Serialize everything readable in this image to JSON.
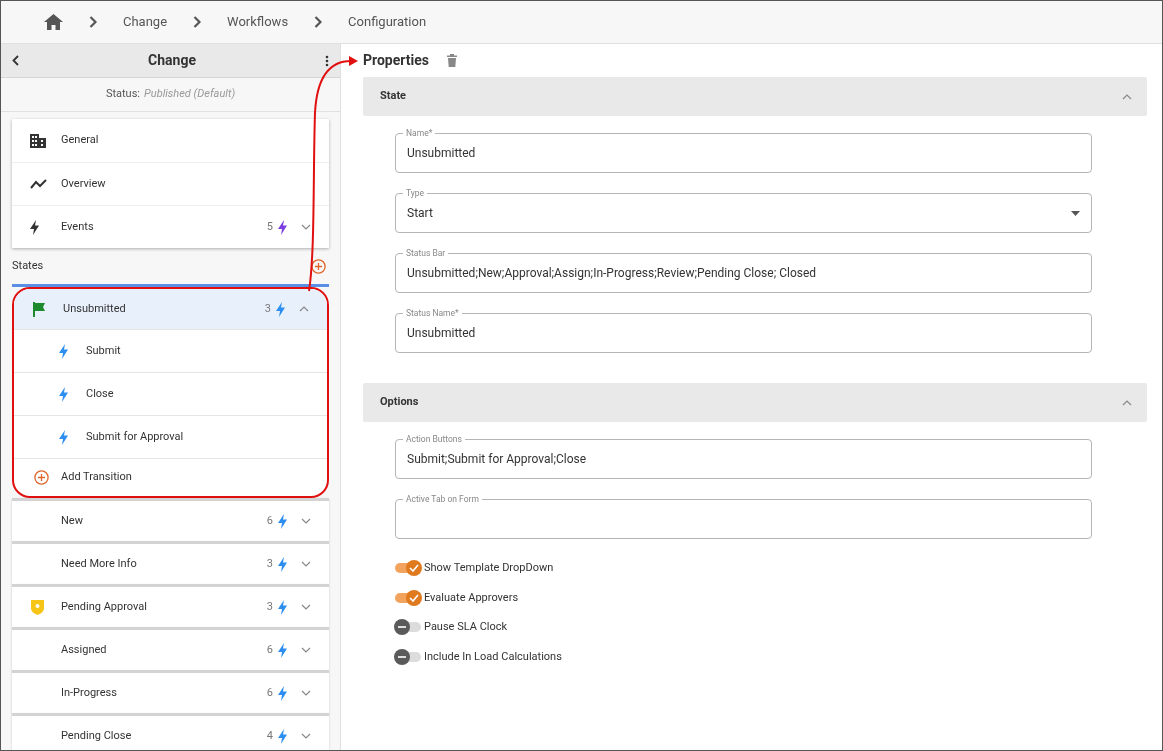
{
  "breadcrumb": [
    {
      "label": "Change"
    },
    {
      "label": "Workflows"
    },
    {
      "label": "Configuration"
    }
  ],
  "sidebar": {
    "title": "Change",
    "status_label": "Status:",
    "status_value": "Published (Default)",
    "items": [
      {
        "label": "General",
        "kind": "building"
      },
      {
        "label": "Overview",
        "kind": "trend"
      },
      {
        "label": "Events",
        "kind": "bolt",
        "count": "5",
        "expanded": false
      }
    ],
    "states_label": "States",
    "states": [
      {
        "name": "Unsubmitted",
        "kind": "flag",
        "count": "3",
        "expanded": true,
        "transitions": [
          "Submit",
          "Close",
          "Submit for Approval"
        ],
        "add_label": "Add Transition"
      },
      {
        "name": "New",
        "count": "6",
        "expanded": false
      },
      {
        "name": "Need More Info",
        "count": "3",
        "expanded": false
      },
      {
        "name": "Pending Approval",
        "kind": "shield",
        "count": "3",
        "expanded": false
      },
      {
        "name": "Assigned",
        "count": "6",
        "expanded": false
      },
      {
        "name": "In-Progress",
        "count": "6",
        "expanded": false
      },
      {
        "name": "Pending Close",
        "count": "4",
        "expanded": false
      }
    ]
  },
  "properties": {
    "title": "Properties",
    "sections": [
      {
        "title": "State",
        "expanded": true,
        "fields": [
          {
            "label": "Name*",
            "value": "Unsubmitted",
            "kind": "text"
          },
          {
            "label": "Type",
            "value": "Start",
            "kind": "select"
          },
          {
            "label": "Status Bar",
            "value": "Unsubmitted;New;Approval;Assign;In-Progress;Review;Pending Close; Closed",
            "kind": "text"
          },
          {
            "label": "Status Name*",
            "value": "Unsubmitted",
            "kind": "text"
          }
        ]
      },
      {
        "title": "Options",
        "expanded": true,
        "fields": [
          {
            "label": "Action Buttons",
            "value": "Submit;Submit for Approval;Close",
            "kind": "text"
          },
          {
            "label": "Active Tab on Form",
            "kind": "text"
          }
        ],
        "toggles": [
          {
            "label": "Show Template DropDown",
            "on": true
          },
          {
            "label": "Evaluate Approvers",
            "on": true
          },
          {
            "label": "Pause SLA Clock",
            "on": false
          },
          {
            "label": "Include In Load Calculations",
            "on": false
          }
        ]
      }
    ]
  }
}
